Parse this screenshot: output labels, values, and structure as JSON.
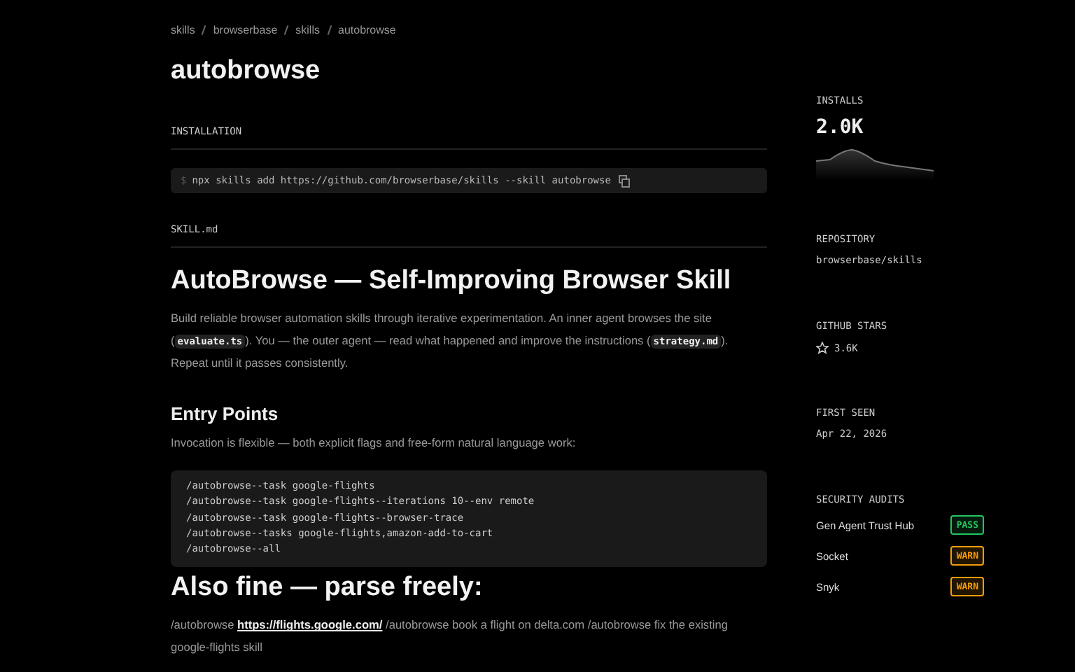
{
  "breadcrumb": [
    "skills",
    "browserbase",
    "skills",
    "autobrowse"
  ],
  "title": "autobrowse",
  "installation": {
    "heading": "INSTALLATION",
    "prompt": "$",
    "command": "npx skills add https://github.com/browserbase/skills --skill autobrowse"
  },
  "skill_file": {
    "heading": "SKILL.md"
  },
  "content": [
    {
      "kind": "h1",
      "text": "AutoBrowse — Self-Improving Browser Skill"
    },
    {
      "kind": "p",
      "parts": [
        {
          "kind": "text",
          "text": "Build reliable browser automation skills through iterative experimentation. An inner agent browses the site ("
        },
        {
          "kind": "code",
          "text": "evaluate.ts"
        },
        {
          "kind": "text",
          "text": "). You — the outer agent — read what happened and improve the instructions ("
        },
        {
          "kind": "code",
          "text": "strategy.md"
        },
        {
          "kind": "text",
          "text": "). Repeat until it passes consistently."
        }
      ]
    },
    {
      "kind": "h2",
      "text": "Entry Points"
    },
    {
      "kind": "p",
      "parts": [
        {
          "kind": "text",
          "text": "Invocation is flexible — both explicit flags and free-form natural language work:"
        }
      ]
    },
    {
      "kind": "pre",
      "lines": [
        "/autobrowse--task google-flights",
        "/autobrowse--task google-flights--iterations 10--env remote",
        "/autobrowse--task google-flights--browser-trace",
        "/autobrowse--tasks google-flights,amazon-add-to-cart",
        "/autobrowse--all"
      ]
    },
    {
      "kind": "h1",
      "text": "Also fine — parse freely:"
    },
    {
      "kind": "p",
      "parts": [
        {
          "kind": "text",
          "text": "/autobrowse "
        },
        {
          "kind": "link",
          "text": "https://flights.google.com/"
        },
        {
          "kind": "text",
          "text": " /autobrowse book a flight on delta.com /autobrowse fix the existing google-flights skill"
        }
      ]
    }
  ],
  "sidebar": {
    "installs": {
      "label": "INSTALLS",
      "value": "2.0K"
    },
    "repository": {
      "label": "REPOSITORY",
      "value": "browserbase/skills"
    },
    "stars": {
      "label": "GITHUB STARS",
      "value": "3.6K"
    },
    "first_seen": {
      "label": "FIRST SEEN",
      "value": "Apr 22, 2026"
    },
    "audits": {
      "label": "SECURITY AUDITS",
      "items": [
        {
          "name": "Gen Agent Trust Hub",
          "status": "PASS",
          "color": "#22c55e"
        },
        {
          "name": "Socket",
          "status": "WARN",
          "color": "#f59e0b"
        },
        {
          "name": "Snyk",
          "status": "WARN",
          "color": "#f59e0b"
        }
      ]
    }
  }
}
